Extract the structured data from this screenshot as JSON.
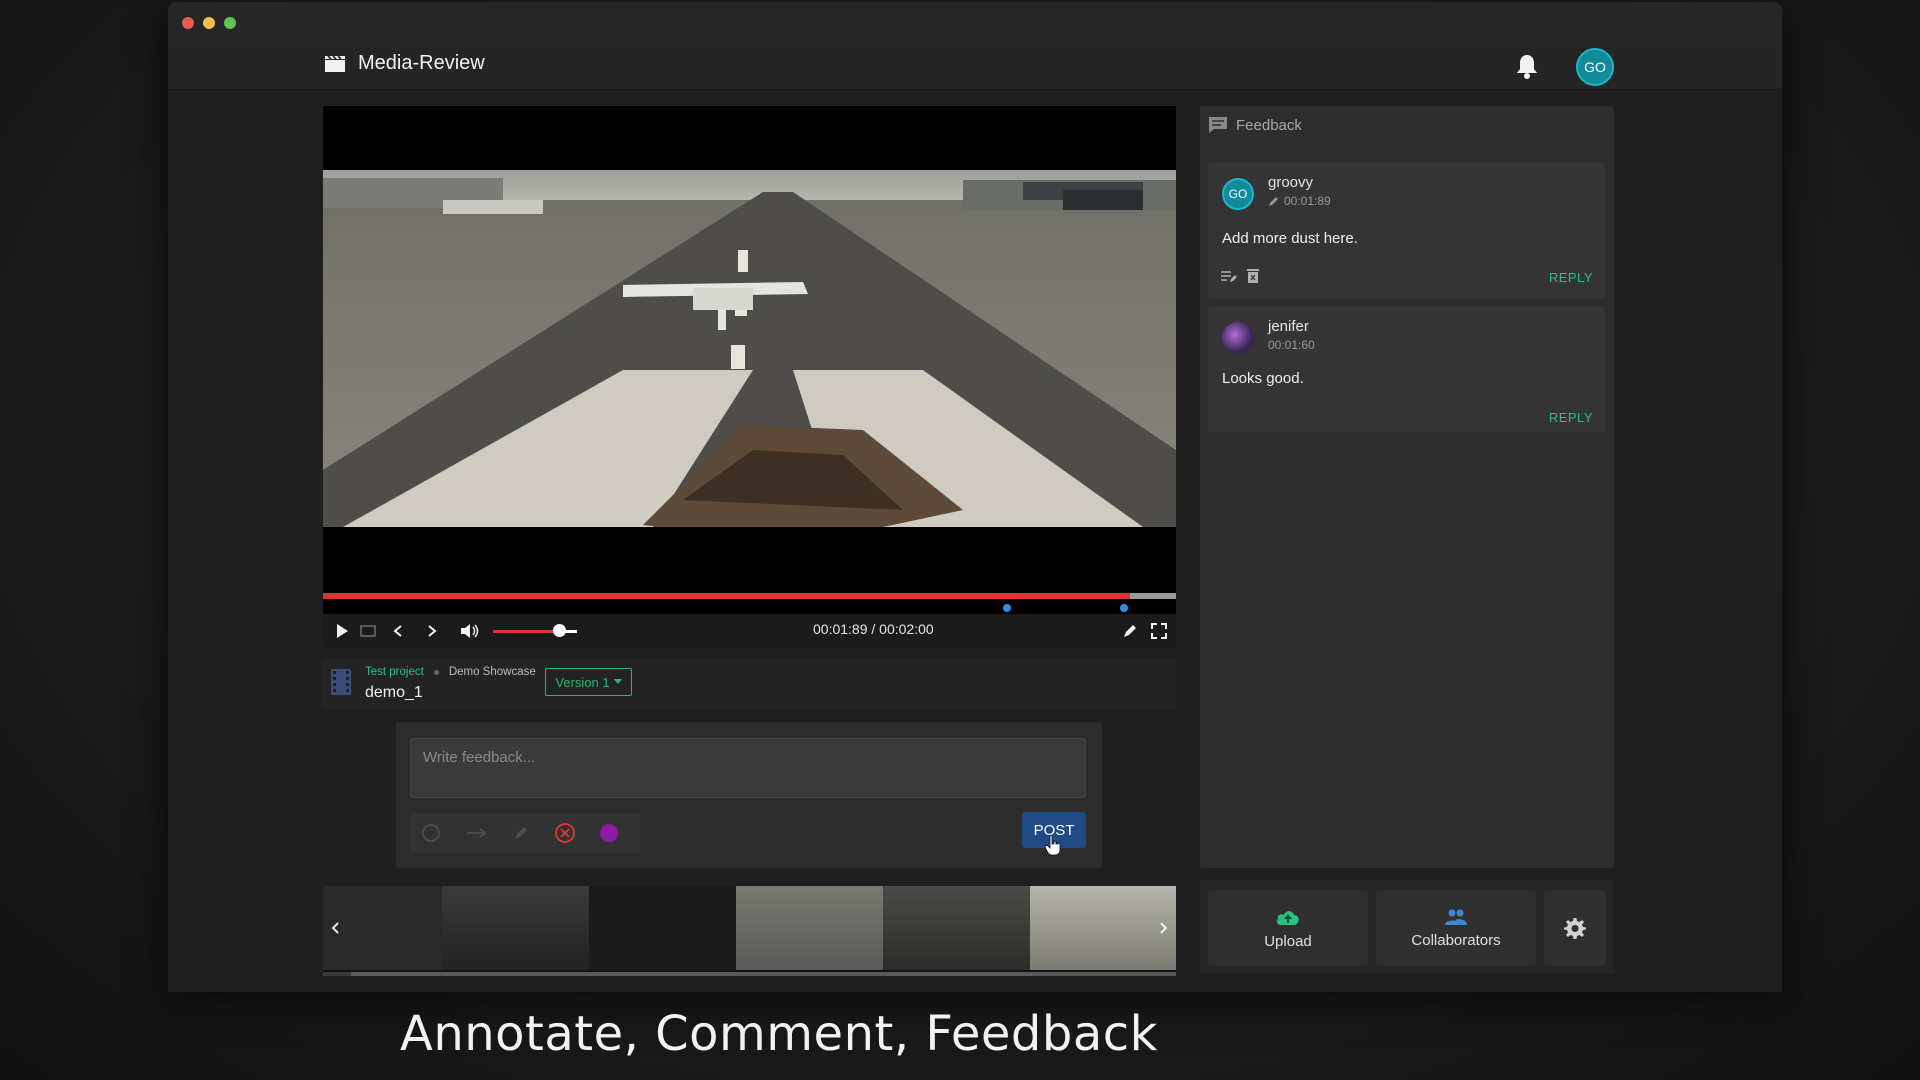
{
  "app": {
    "title": "Media-Review",
    "user_initials": "GO"
  },
  "player": {
    "timecode": "00:01:89 / 00:02:00",
    "progress": 0.946,
    "volume": 0.78,
    "comment_markers": [
      0.802,
      0.939
    ]
  },
  "breadcrumb": {
    "project": "Test project",
    "showcase": "Demo Showcase"
  },
  "file": {
    "name": "demo_1",
    "version": "Version 1"
  },
  "composer": {
    "placeholder": "Write feedback...",
    "post_label": "POST",
    "annotation_color": "#8e1aa8"
  },
  "feedback": {
    "title": "Feedback",
    "comments": [
      {
        "author": "groovy",
        "initials": "GO",
        "time": "00:01:89",
        "text": "Add more dust here.",
        "reply": "REPLY"
      },
      {
        "author": "jenifer",
        "initials": "",
        "time": "00:01:60",
        "text": "Looks good.",
        "reply": "REPLY"
      }
    ]
  },
  "actions": {
    "upload": "Upload",
    "collaborators": "Collaborators"
  },
  "caption": "Annotate, Comment, Feedback",
  "colors": {
    "accent_green": "#26c281",
    "progress_red": "#e0332f",
    "post_blue": "#1f4a86",
    "avatar_teal": "#118a9a"
  }
}
